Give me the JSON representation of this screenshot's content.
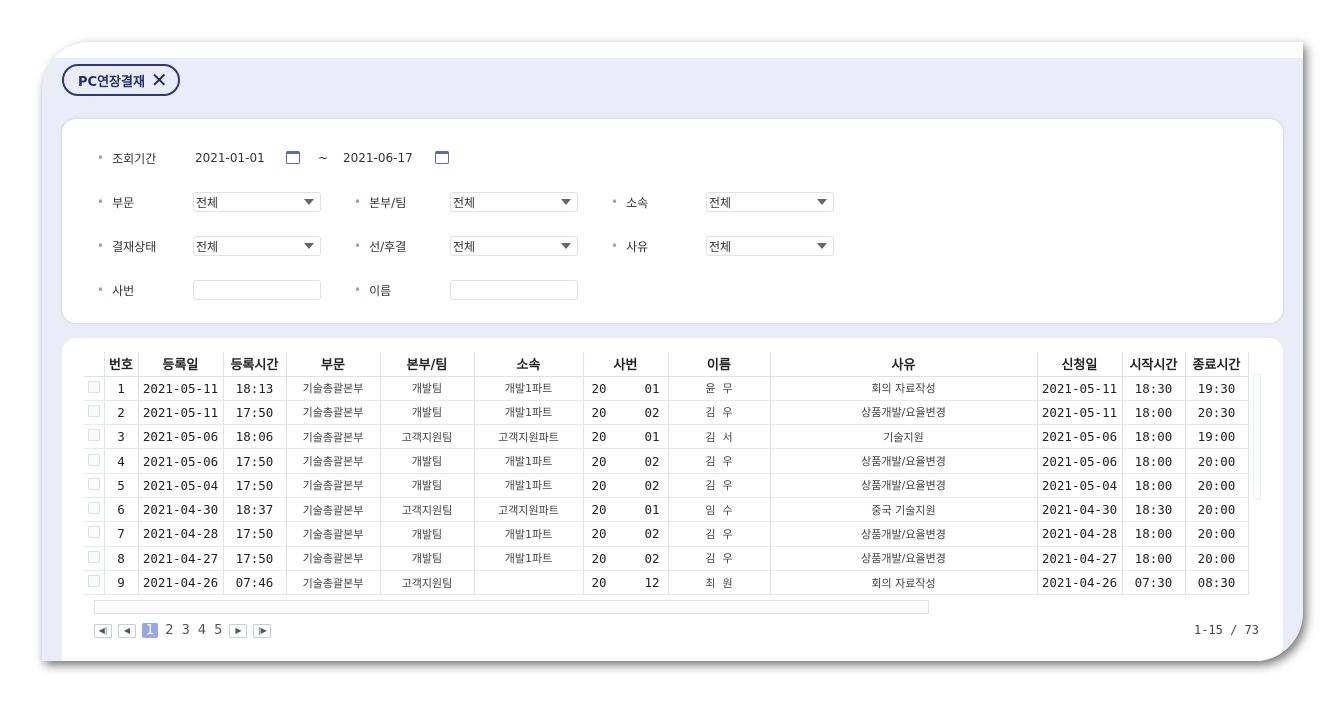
{
  "tab": {
    "label": "PC연장결재",
    "close_icon": "close-icon"
  },
  "search": {
    "period_label": "조회기간",
    "date_from": "2021-01-01",
    "date_sep": "~",
    "date_to": "2021-06-17",
    "dept_label": "부문",
    "dept_value": "전체",
    "team_label": "본부/팀",
    "team_value": "전체",
    "affil_label": "소속",
    "affil_value": "전체",
    "status_label": "결재상태",
    "status_value": "전체",
    "prepost_label": "선/후결",
    "prepost_value": "전체",
    "reason_label": "사유",
    "reason_value": "전체",
    "empno_label": "사번",
    "empno_value": "",
    "name_label": "이름",
    "name_value": ""
  },
  "grid": {
    "columns": [
      "번호",
      "등록일",
      "등록시간",
      "부문",
      "본부/팀",
      "소속",
      "사번",
      "이름",
      "사유",
      "신청일",
      "시작시간",
      "종료시간"
    ],
    "rows": [
      {
        "no": "1",
        "reg_date": "2021-05-11",
        "reg_time": "18:13",
        "dept": "기술총괄본부",
        "team": "개발팀",
        "affil": "개발1파트",
        "empno_a": "20",
        "empno_b": "01",
        "name": "윤  무",
        "reason": "회의 자료작성",
        "apply_date": "2021-05-11",
        "start": "18:30",
        "end": "19:30"
      },
      {
        "no": "2",
        "reg_date": "2021-05-11",
        "reg_time": "17:50",
        "dept": "기술총괄본부",
        "team": "개발팀",
        "affil": "개발1파트",
        "empno_a": "20",
        "empno_b": "02",
        "name": "김  우",
        "reason": "상품개발/요율변경",
        "apply_date": "2021-05-11",
        "start": "18:00",
        "end": "20:30"
      },
      {
        "no": "3",
        "reg_date": "2021-05-06",
        "reg_time": "18:06",
        "dept": "기술총괄본부",
        "team": "고객지원팀",
        "affil": "고객지원파트",
        "empno_a": "20",
        "empno_b": "01",
        "name": "김  서",
        "reason": "기술지원",
        "apply_date": "2021-05-06",
        "start": "18:00",
        "end": "19:00"
      },
      {
        "no": "4",
        "reg_date": "2021-05-06",
        "reg_time": "17:50",
        "dept": "기술총괄본부",
        "team": "개발팀",
        "affil": "개발1파트",
        "empno_a": "20",
        "empno_b": "02",
        "name": "김  우",
        "reason": "상품개발/요율변경",
        "apply_date": "2021-05-06",
        "start": "18:00",
        "end": "20:00"
      },
      {
        "no": "5",
        "reg_date": "2021-05-04",
        "reg_time": "17:50",
        "dept": "기술총괄본부",
        "team": "개발팀",
        "affil": "개발1파트",
        "empno_a": "20",
        "empno_b": "02",
        "name": "김  우",
        "reason": "상품개발/요율변경",
        "apply_date": "2021-05-04",
        "start": "18:00",
        "end": "20:00"
      },
      {
        "no": "6",
        "reg_date": "2021-04-30",
        "reg_time": "18:37",
        "dept": "기술총괄본부",
        "team": "고객지원팀",
        "affil": "고객지원파트",
        "empno_a": "20",
        "empno_b": "01",
        "name": "임  수",
        "reason": "중국 기술지원",
        "apply_date": "2021-04-30",
        "start": "18:30",
        "end": "20:00"
      },
      {
        "no": "7",
        "reg_date": "2021-04-28",
        "reg_time": "17:50",
        "dept": "기술총괄본부",
        "team": "개발팀",
        "affil": "개발1파트",
        "empno_a": "20",
        "empno_b": "02",
        "name": "김  우",
        "reason": "상품개발/요율변경",
        "apply_date": "2021-04-28",
        "start": "18:00",
        "end": "20:00"
      },
      {
        "no": "8",
        "reg_date": "2021-04-27",
        "reg_time": "17:50",
        "dept": "기술총괄본부",
        "team": "개발팀",
        "affil": "개발1파트",
        "empno_a": "20",
        "empno_b": "02",
        "name": "김  우",
        "reason": "상품개발/요율변경",
        "apply_date": "2021-04-27",
        "start": "18:00",
        "end": "20:00"
      },
      {
        "no": "9",
        "reg_date": "2021-04-26",
        "reg_time": "07:46",
        "dept": "기술총괄본부",
        "team": "고객지원팀",
        "affil": "",
        "empno_a": "20",
        "empno_b": "12",
        "name": "최  원",
        "reason": "회의 자료작성",
        "apply_date": "2021-04-26",
        "start": "07:30",
        "end": "08:30"
      }
    ]
  },
  "pager": {
    "first_icon": "first-page-icon",
    "prev_icon": "prev-page-icon",
    "next_icon": "next-page-icon",
    "last_icon": "last-page-icon",
    "pages": [
      "1",
      "2",
      "3",
      "4",
      "5"
    ],
    "current": "1",
    "info": "1-15 / 73"
  }
}
